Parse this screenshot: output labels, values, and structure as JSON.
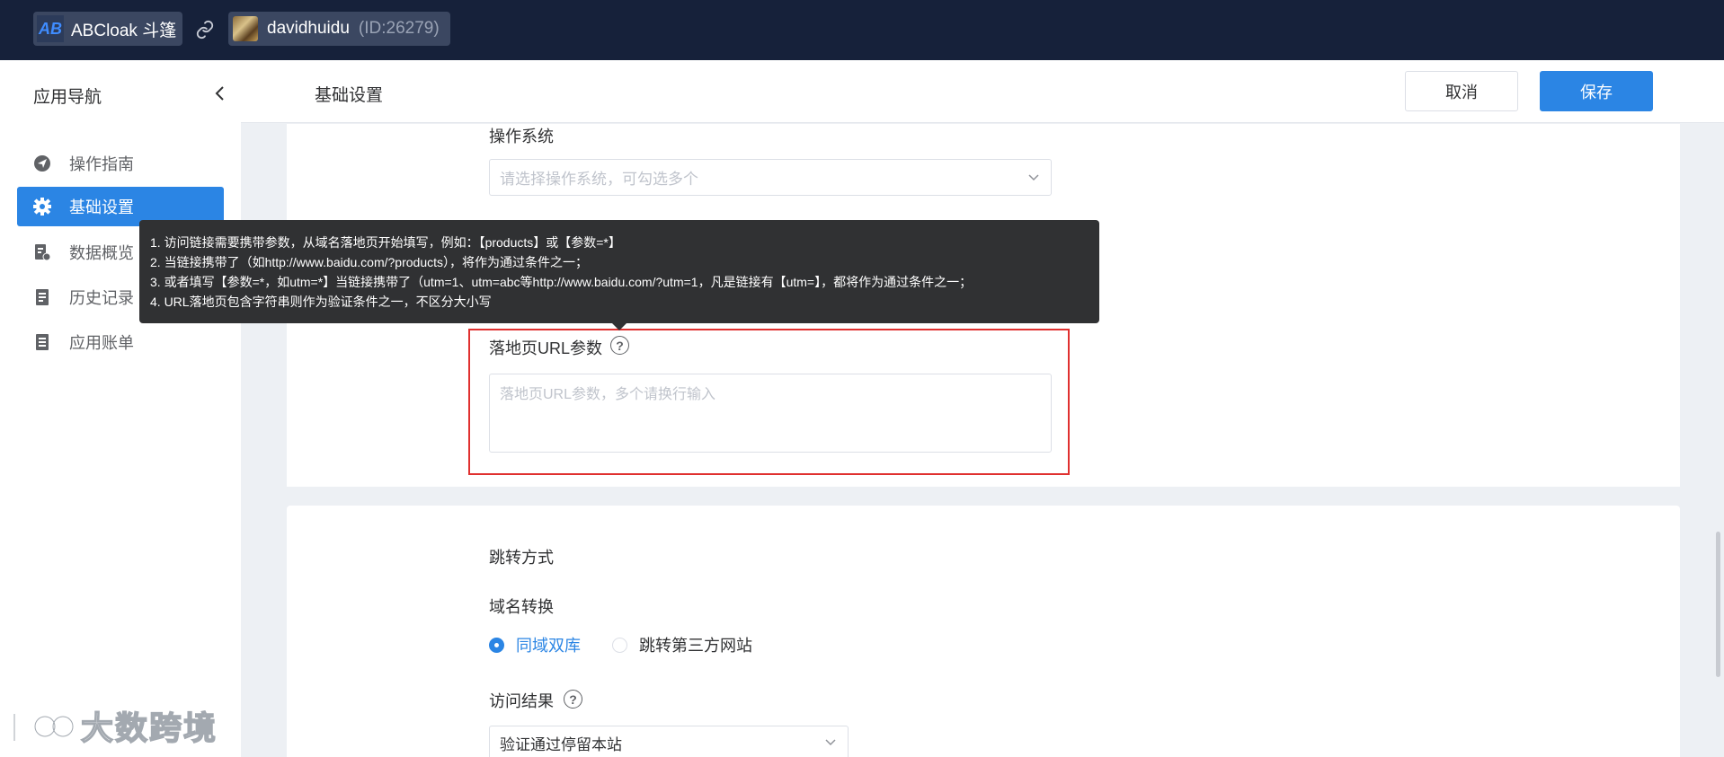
{
  "topbar": {
    "app_logo": "AB",
    "app_name": "ABCloak 斗篷",
    "user_name": "davidhuidu",
    "user_id": "(ID:26279)"
  },
  "sidebar": {
    "title": "应用导航",
    "items": [
      {
        "label": "操作指南",
        "icon": "send-icon",
        "active": false
      },
      {
        "label": "基础设置",
        "icon": "gear-icon",
        "active": true
      },
      {
        "label": "数据概览",
        "icon": "data-report-icon",
        "active": false
      },
      {
        "label": "历史记录",
        "icon": "document-icon",
        "active": false
      },
      {
        "label": "应用账单",
        "icon": "bill-icon",
        "active": false
      }
    ]
  },
  "header": {
    "title": "基础设置",
    "cancel_label": "取消",
    "save_label": "保存"
  },
  "form": {
    "os_label": "操作系统",
    "os_placeholder": "请选择操作系统，可勾选多个",
    "url_param_label": "落地页URL参数",
    "url_param_placeholder": "落地页URL参数，多个请换行输入",
    "tooltip_lines": [
      "1. 访问链接需要携带参数，从域名落地页开始填写，例如：【products】或【参数=*】",
      "2. 当链接携带了（如http://www.baidu.com/?products），将作为通过条件之一；",
      "3. 或者填写【参数=*，如utm=*】当链接携带了（utm=1、utm=abc等http://www.baidu.com/?utm=1，凡是链接有【utm=】，都将作为通过条件之一；",
      "4. URL落地页包含字符串则作为验证条件之一，不区分大小写"
    ],
    "redirect_section_title": "跳转方式",
    "domain_convert_label": "域名转换",
    "radio_options": [
      {
        "label": "同域双库",
        "checked": true
      },
      {
        "label": "跳转第三方网站",
        "checked": false
      }
    ],
    "visit_result_label": "访问结果",
    "visit_result_value": "验证通过停留本站"
  },
  "watermark": {
    "text": "大数跨境"
  },
  "colors": {
    "topbar_bg": "#16213a",
    "primary": "#2b85e4",
    "highlight": "#e0302f",
    "tooltip_bg": "#303133"
  }
}
